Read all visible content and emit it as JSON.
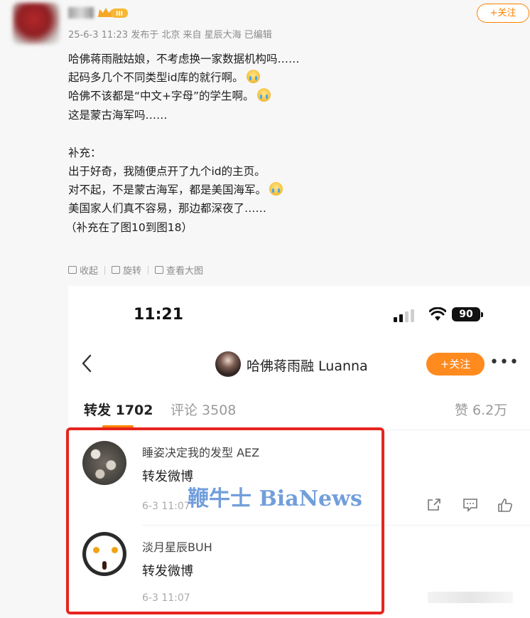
{
  "post": {
    "follow_label": "+关注",
    "vip_text": "III",
    "meta": "25-6-3 11:23 发布于 北京 来自 星辰大海 已编辑",
    "lines": [
      "哈佛蒋雨融姑娘，不考虑换一家数据机构吗……",
      "起码多几个不同类型id库的就行啊。",
      "哈佛不该都是“中文+字母”的学生啊。",
      "这是蒙古海军吗……",
      "补充：",
      "出于好奇，我随便点开了九个id的主页。",
      "对不起，不是蒙古海军，都是美国海军。",
      "美国家人们真不容易，那边都深夜了……",
      "（补充在了图10到图18）"
    ],
    "tools": [
      "收起",
      "旋转",
      "查看大图"
    ]
  },
  "phone": {
    "time": "11:21",
    "battery": "90",
    "header_name": "哈佛蒋雨融 Luanna",
    "follow_label": "+关注",
    "more": "•••",
    "tabs": {
      "repost": "转发 1702",
      "comment": "评论 3508",
      "like": "赞 6.2万"
    },
    "reposts": [
      {
        "user": "睡姿决定我的发型 AEZ",
        "text": "转发微博",
        "time": "6-3 11:07"
      },
      {
        "user": "淡月星辰BUH",
        "text": "转发微博",
        "time": "6-3 11:07"
      }
    ],
    "watermark": "鞭牛士 BiaNews"
  },
  "colors": {
    "accent": "#ff8200",
    "highlight_box": "#e5251e",
    "watermark": "#3c78cd"
  }
}
